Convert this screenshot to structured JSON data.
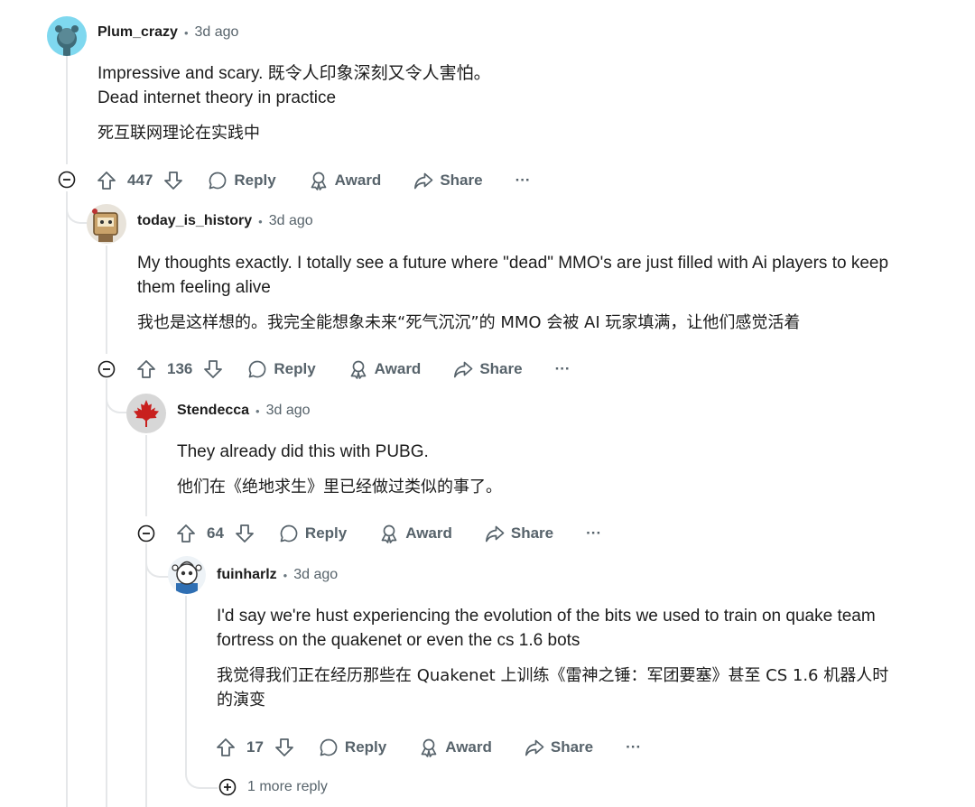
{
  "comments": [
    {
      "username": "Plum_crazy",
      "time": "3d ago",
      "lines": [
        "Impressive and scary.  既令人印象深刻又令人害怕。",
        "Dead internet theory in practice"
      ],
      "translation": "死互联网理论在实践中",
      "score": "447"
    },
    {
      "username": "today_is_history",
      "time": "3d ago",
      "lines": [
        "My thoughts exactly. I totally see a future where \"dead\" MMO's are just filled with Ai players to keep",
        "them feeling alive"
      ],
      "translation": "我也是这样想的。我完全能想象未来“死气沉沉”的 MMO 会被 AI 玩家填满，让他们感觉活着",
      "score": "136"
    },
    {
      "username": "Stendecca",
      "time": "3d ago",
      "lines": [
        "They already did this with PUBG."
      ],
      "translation": "他们在《绝地求生》里已经做过类似的事了。",
      "score": "64"
    },
    {
      "username": "fuinharlz",
      "time": "3d ago",
      "lines": [
        "I'd say we're hust experiencing the evolution of the bits we used to train on quake team",
        "fortress on the quakenet or even the cs 1.6 bots"
      ],
      "translation_lines": [
        "我觉得我们正在经历那些在 Quakenet 上训练《雷神之锤：军团要塞》甚至 CS 1.6 机器人时",
        "的演变"
      ],
      "score": "17"
    }
  ],
  "actions": {
    "reply": "Reply",
    "award": "Award",
    "share": "Share",
    "more": "···"
  },
  "more_replies": "1 more reply",
  "colors": {
    "text": "#1c1c1c",
    "muted": "#57636b",
    "thread": "#e5e7e9",
    "avatar_blue": "#7fd8ef"
  },
  "icons": [
    "upvote-icon",
    "downvote-icon",
    "reply-icon",
    "award-icon",
    "share-icon",
    "collapse-icon",
    "expand-icon",
    "overflow-icon"
  ]
}
